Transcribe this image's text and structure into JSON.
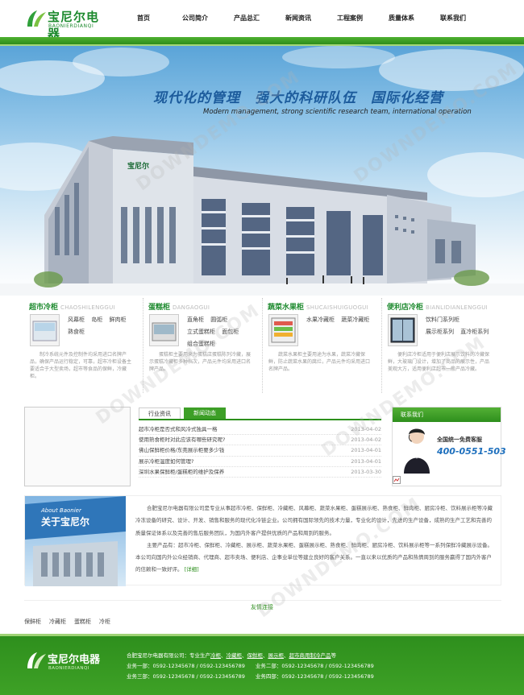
{
  "logo": {
    "cn": "宝尼尔电器",
    "en": "BAONIERDIANQI"
  },
  "nav": [
    "首页",
    "公司简介",
    "产品总汇",
    "新闻资讯",
    "工程案例",
    "质量体系",
    "联系我们"
  ],
  "banner": {
    "slogan": "现代化的管理　强大的科研队伍　国际化经营",
    "slogan_en": "Modern management, strong scientific research team, international operation",
    "building_sign": "宝尼尔"
  },
  "categories": [
    {
      "title": "超市冷柜",
      "pinyin": "CHAOSHILENGGUI",
      "links": [
        "风幕柜",
        "岛柜",
        "鲜肉柜",
        "熟食柜"
      ],
      "desc": "制冷系统元件及控制件均采用进口名牌产品，确保产品运行稳定，可靠，超市冷柜设备主要适合于大型卖场，超市等食品的保鲜，冷藏柜。"
    },
    {
      "title": "蛋糕柜",
      "pinyin": "DANGAOGUI",
      "links": [
        "直角柜",
        "圆弧柜",
        "立式蛋糕柜",
        "面包柜",
        "组合蛋糕柜"
      ],
      "desc": "蛋糕柜主要用来为蛋糕店蛋糕陈列冷藏，展示蛋糕冷藏柜多种档次，产品元件均采用进口名牌产品。"
    },
    {
      "title": "蔬菜水果柜",
      "pinyin": "SHUCAISHUIGUOGUI",
      "links": [
        "水果冷藏柜",
        "蔬菜冷藏柜"
      ],
      "desc": "蔬菜水果柜主要用途为水果，蔬菜冷藏保鲜，防止蔬菜水果的腐烂，产品元件均采用进口名牌产品。"
    },
    {
      "title": "便利店冷柜",
      "pinyin": "BIANLIDIANLENGGUI",
      "links": [
        "饮料门系列柜",
        "展示柜系列",
        "直冷柜系列"
      ],
      "desc": "便利店冷柜适用于便利店展示饮料的冷藏保鲜，大玻璃门设计，增加了商品的展示性，产品美观大方，适用便利店超市一般产品冷藏。"
    }
  ],
  "news": {
    "tabs": [
      "行业资讯",
      "新闻动态"
    ],
    "items": [
      {
        "title": "超市冷柜是否式和风冷式独具一格",
        "date": "2013-04-02"
      },
      {
        "title": "使用熟食柜时对此应该有哪些研究呢?",
        "date": "2013-04-02"
      },
      {
        "title": "佛山保鲜柜价格/东莞展示柜要多少钱",
        "date": "2013-04-01"
      },
      {
        "title": "展示冷柜温度如何管理?",
        "date": "2013-04-01"
      },
      {
        "title": "深圳水果保鲜柜/蛋糕柜的维护及保养",
        "date": "2013-03-30"
      }
    ]
  },
  "contact": {
    "head": "联系我们",
    "label": "全国统一免费客服",
    "phone": "400-0551-503"
  },
  "about": {
    "en": "About Baonier",
    "cn": "关于宝尼尔",
    "p1": "合肥宝尼尔电器有限公司是专业从事超市冷柜、保鲜柜、冷藏柜、风幕柜、蔬菜水果柜、蛋糕展示柜、熟食柜、鲜肉柜、厨房冷柜、饮料展示柜等冷藏冷冻设备的研究、设计、开发、销售和服务的现代化冷链企业。公司拥有国际领先的技术力量，专业化的设计，先进的生产设备，成熟的生产工艺和完善的质量保证体系以及完善的售后服务团队，为国内外客户提供优质的产品和周到的服务。",
    "p2": "主要产品有：超市冷柜、保鲜柜、冷藏柜、展示柜、蔬菜水果柜、蛋糕展示柜、熟食柜、鲜肉柜、厨房冷柜、饮料展示柜等一系列保鲜冷藏展示设备。本公司向国内外公众经销商、代理商、超市卖场、便利店、企事业单位等建立良好的客户关系。一直以来以优质的产品和热情周到的服务赢得了国内外客户的信赖和一致好评。",
    "more": "[详细]"
  },
  "links": {
    "title": "友情连接",
    "items": [
      "保鲜柜",
      "冷藏柜",
      "蛋糕柜",
      "冷柜"
    ]
  },
  "footer": {
    "logo_cn": "宝尼尔电器",
    "logo_en": "BAONIERDIANQI",
    "line1_pre": "合肥宝尼尔电器有限公司：专业生产",
    "line1_items": [
      "冷柜",
      "冷藏柜",
      "保鲜柜",
      "展示柜",
      "超市商用制冷产品"
    ],
    "line1_post": "等",
    "line2": "业务一部：0592-12345678 / 0592-123456789　　业务二部：0592-12345678 / 0592-123456789",
    "line3": "业务三部：0592-12345678 / 0592-123456789　　业务四部：0592-12345678 / 0592-123456789"
  },
  "colors": {
    "green": "#2c8f1c",
    "blue": "#1c5b9c",
    "phone": "#1d6fbd"
  }
}
